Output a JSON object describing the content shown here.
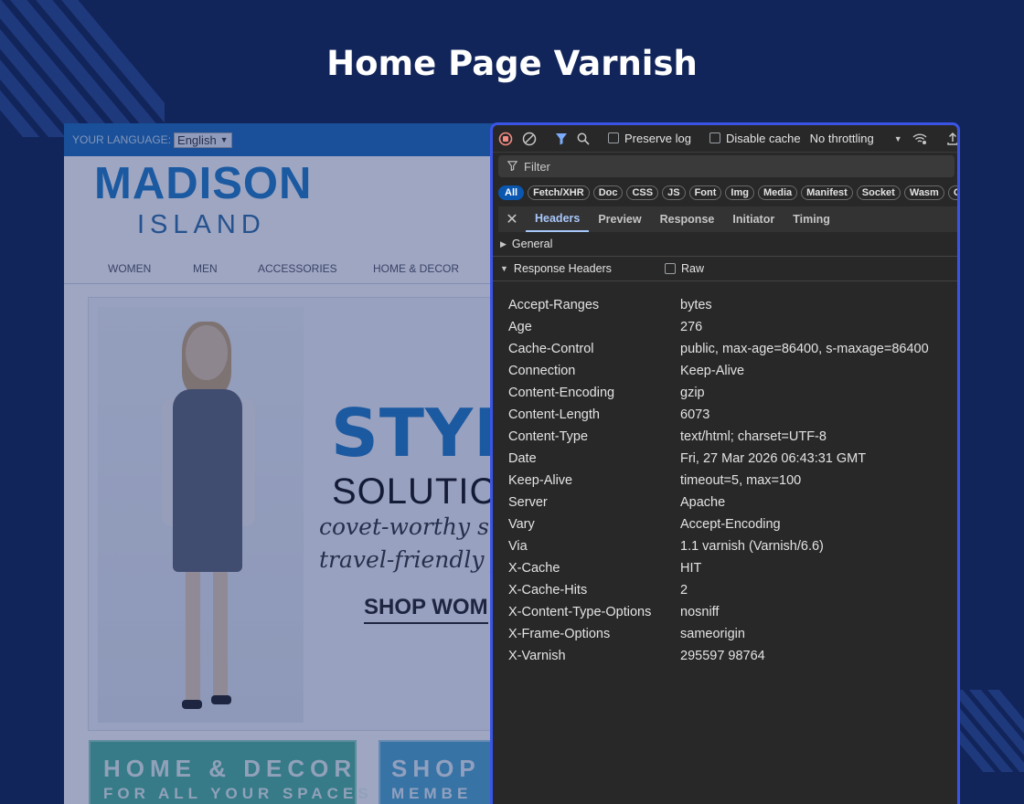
{
  "page": {
    "title": "Home Page Varnish"
  },
  "store": {
    "language_label": "YOUR LANGUAGE:",
    "language_value": "English",
    "logo_main": "MADISON",
    "logo_sub": "ISLAND",
    "nav": [
      "WOMEN",
      "MEN",
      "ACCESSORIES",
      "HOME & DECOR"
    ],
    "hero": {
      "headline": "STYL",
      "subheadline": "SOLUTIC",
      "tagline_1": "covet-worthy st",
      "tagline_2": "travel-friendly f",
      "cta": "SHOP WOM"
    },
    "promo_1": {
      "title": "HOME & DECOR",
      "subtitle": "FOR ALL YOUR SPACES"
    },
    "promo_2": {
      "title": "SHOP PR",
      "subtitle": "MEMBE"
    }
  },
  "devtools": {
    "toolbar": {
      "preserve_log": "Preserve log",
      "disable_cache": "Disable cache",
      "throttling": "No throttling"
    },
    "filter_placeholder": "Filter",
    "type_filters": [
      "All",
      "Fetch/XHR",
      "Doc",
      "CSS",
      "JS",
      "Font",
      "Img",
      "Media",
      "Manifest",
      "Socket",
      "Wasm",
      "Ot"
    ],
    "active_filter": "All",
    "tabs": [
      "Headers",
      "Preview",
      "Response",
      "Initiator",
      "Timing"
    ],
    "active_tab": "Headers",
    "section_general": "General",
    "section_response_headers": "Response Headers",
    "raw_label": "Raw",
    "response_headers": [
      {
        "name": "Accept-Ranges",
        "value": "bytes"
      },
      {
        "name": "Age",
        "value": "276"
      },
      {
        "name": "Cache-Control",
        "value": "public, max-age=86400, s-maxage=86400"
      },
      {
        "name": "Connection",
        "value": "Keep-Alive"
      },
      {
        "name": "Content-Encoding",
        "value": "gzip"
      },
      {
        "name": "Content-Length",
        "value": "6073"
      },
      {
        "name": "Content-Type",
        "value": "text/html; charset=UTF-8"
      },
      {
        "name": "Date",
        "value": "Fri, 27 Mar 2026 06:43:31 GMT"
      },
      {
        "name": "Keep-Alive",
        "value": "timeout=5, max=100"
      },
      {
        "name": "Server",
        "value": "Apache"
      },
      {
        "name": "Vary",
        "value": "Accept-Encoding"
      },
      {
        "name": "Via",
        "value": "1.1 varnish (Varnish/6.6)"
      },
      {
        "name": "X-Cache",
        "value": "HIT"
      },
      {
        "name": "X-Cache-Hits",
        "value": "2"
      },
      {
        "name": "X-Content-Type-Options",
        "value": "nosniff"
      },
      {
        "name": "X-Frame-Options",
        "value": "sameorigin"
      },
      {
        "name": "X-Varnish",
        "value": "295597 98764"
      }
    ]
  },
  "colors": {
    "background": "#12255a",
    "devtools_border": "#3a55e6",
    "devtools_bg": "#282828",
    "active_tab": "#a8c7fa",
    "active_chip": "#0b57b0"
  }
}
